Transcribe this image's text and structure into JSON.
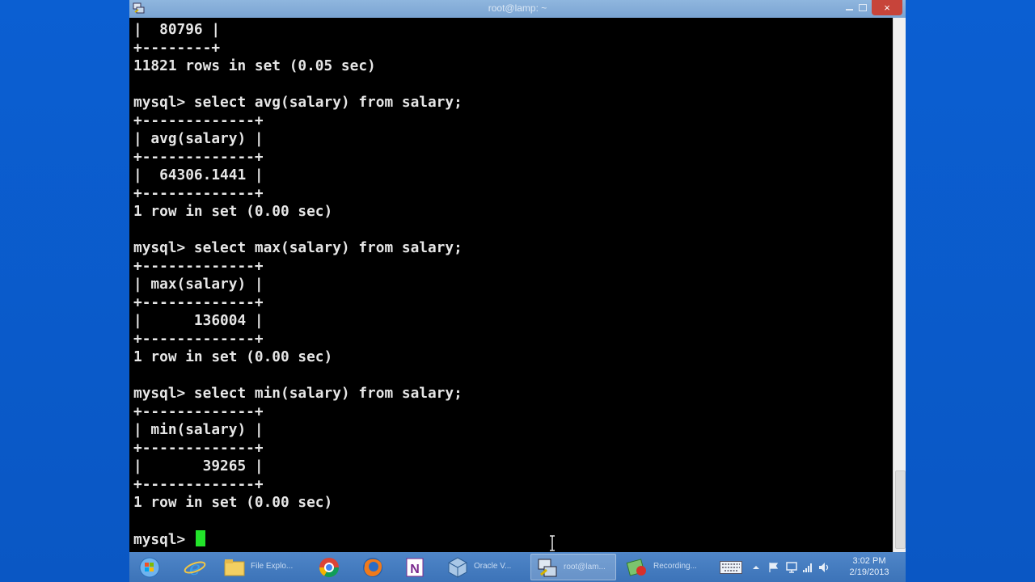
{
  "window": {
    "title": "root@lamp: ~",
    "close_label": "×"
  },
  "terminal": {
    "lines": [
      "|  80796 |",
      "+--------+",
      "11821 rows in set (0.05 sec)",
      "",
      "mysql> select avg(salary) from salary;",
      "+-------------+",
      "| avg(salary) |",
      "+-------------+",
      "|  64306.1441 |",
      "+-------------+",
      "1 row in set (0.00 sec)",
      "",
      "mysql> select max(salary) from salary;",
      "+-------------+",
      "| max(salary) |",
      "+-------------+",
      "|      136004 |",
      "+-------------+",
      "1 row in set (0.00 sec)",
      "",
      "mysql> select min(salary) from salary;",
      "+-------------+",
      "| min(salary) |",
      "+-------------+",
      "|       39265 |",
      "+-------------+",
      "1 row in set (0.00 sec)",
      ""
    ],
    "prompt": "mysql> ",
    "cursor_color": "#22e32a"
  },
  "taskbar": {
    "items": [
      {
        "id": "start",
        "icon": "windows-start-icon"
      },
      {
        "id": "ie",
        "icon": "internet-explorer-icon"
      },
      {
        "id": "explorer",
        "icon": "folder-icon",
        "label": "File Explo..."
      },
      {
        "id": "chrome",
        "icon": "chrome-icon"
      },
      {
        "id": "firefox",
        "icon": "firefox-icon"
      },
      {
        "id": "onenote",
        "icon": "onenote-icon"
      },
      {
        "id": "virtualbox",
        "icon": "virtualbox-icon",
        "label": "Oracle V..."
      },
      {
        "id": "putty",
        "icon": "putty-icon",
        "label": "root@lam..."
      },
      {
        "id": "recording",
        "icon": "recording-icon",
        "label": "Recording..."
      }
    ],
    "clock_time": "3:02 PM",
    "clock_date": "2/19/2013"
  },
  "colors": {
    "desktop": "#0d63d6",
    "taskbar": "#3c73b8",
    "terminal_bg": "#000000",
    "terminal_fg": "#e6e6e6"
  }
}
